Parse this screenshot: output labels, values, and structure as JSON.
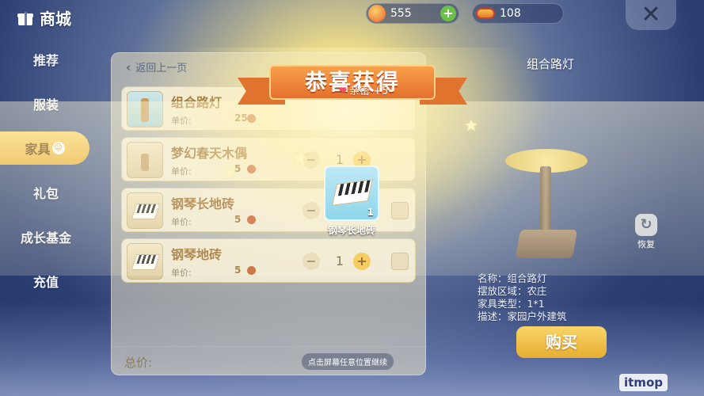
{
  "topbar": {
    "title": "商城",
    "currency_coins": "555",
    "currency_hotdog": "108",
    "close_label": "✕"
  },
  "sidebar": {
    "items": [
      {
        "label": "推荐"
      },
      {
        "label": "服装"
      },
      {
        "label": "家具"
      },
      {
        "label": "礼包"
      },
      {
        "label": "成长基金"
      },
      {
        "label": "充值"
      }
    ],
    "active_badge": "☺"
  },
  "list_panel": {
    "back_label": "返回上一页",
    "items": [
      {
        "name": "组合路灯",
        "price_label": "单价:",
        "price": "25",
        "qty": ""
      },
      {
        "name": "梦幻春天木偶",
        "price_label": "单价:",
        "price": "5",
        "qty": "1"
      },
      {
        "name": "钢琴长地砖",
        "price_label": "单价:",
        "price": "5",
        "qty": ""
      },
      {
        "name": "钢琴地砖",
        "price_label": "单价:",
        "price": "5",
        "qty": "1"
      }
    ],
    "total_label": "总价:",
    "tap_hint": "点击屏幕任意位置继续"
  },
  "preview": {
    "title": "组合路灯",
    "reset_label": "恢复",
    "detail_lines": [
      "名称：组合路灯",
      "摆放区域：农庄",
      "家具类型：1*1",
      "描述：家园户外建筑"
    ],
    "buy_label": "购买"
  },
  "reward": {
    "banner_title": "恭喜获得",
    "intimacy_text": "亲密 +5",
    "item_name": "钢琴长地砖",
    "item_count": "1"
  },
  "watermark": "itmop",
  "colors": {
    "accent_gold": "#f2c243",
    "ribbon_orange": "#e4702d",
    "panel_bg": "#ebe1c3",
    "item_text": "#9a6b2c"
  }
}
